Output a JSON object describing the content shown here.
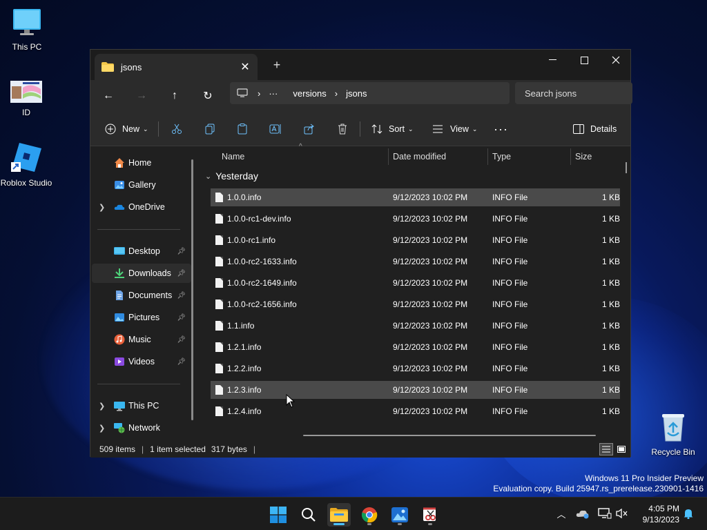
{
  "desktop": {
    "icons": [
      {
        "label": "This PC"
      },
      {
        "label": "ID"
      },
      {
        "label": "Roblox Studio"
      },
      {
        "label": "Recycle Bin"
      }
    ],
    "watermark_line1": "Windows 11 Pro Insider Preview",
    "watermark_line2": "Evaluation copy. Build 25947.rs_prerelease.230901-1416"
  },
  "window": {
    "tab_title": "jsons",
    "new_tab": "+",
    "breadcrumbs": [
      "···",
      "versions",
      "jsons"
    ],
    "search_placeholder": "Search jsons",
    "commands": {
      "new": "New",
      "sort": "Sort",
      "view": "View",
      "details": "Details"
    }
  },
  "nav_pane": {
    "items": [
      {
        "label": "Home"
      },
      {
        "label": "Gallery"
      },
      {
        "label": "OneDrive"
      },
      {
        "label": "Desktop"
      },
      {
        "label": "Downloads"
      },
      {
        "label": "Documents"
      },
      {
        "label": "Pictures"
      },
      {
        "label": "Music"
      },
      {
        "label": "Videos"
      },
      {
        "label": "This PC"
      },
      {
        "label": "Network"
      }
    ]
  },
  "file_list": {
    "columns": [
      "Name",
      "Date modified",
      "Type",
      "Size"
    ],
    "group": "Yesterday",
    "rows": [
      {
        "name": "1.0.0.info",
        "date": "9/12/2023 10:02 PM",
        "type": "INFO File",
        "size": "1 KB"
      },
      {
        "name": "1.0.0-rc1-dev.info",
        "date": "9/12/2023 10:02 PM",
        "type": "INFO File",
        "size": "1 KB"
      },
      {
        "name": "1.0.0-rc1.info",
        "date": "9/12/2023 10:02 PM",
        "type": "INFO File",
        "size": "1 KB"
      },
      {
        "name": "1.0.0-rc2-1633.info",
        "date": "9/12/2023 10:02 PM",
        "type": "INFO File",
        "size": "1 KB"
      },
      {
        "name": "1.0.0-rc2-1649.info",
        "date": "9/12/2023 10:02 PM",
        "type": "INFO File",
        "size": "1 KB"
      },
      {
        "name": "1.0.0-rc2-1656.info",
        "date": "9/12/2023 10:02 PM",
        "type": "INFO File",
        "size": "1 KB"
      },
      {
        "name": "1.1.info",
        "date": "9/12/2023 10:02 PM",
        "type": "INFO File",
        "size": "1 KB"
      },
      {
        "name": "1.2.1.info",
        "date": "9/12/2023 10:02 PM",
        "type": "INFO File",
        "size": "1 KB"
      },
      {
        "name": "1.2.2.info",
        "date": "9/12/2023 10:02 PM",
        "type": "INFO File",
        "size": "1 KB"
      },
      {
        "name": "1.2.3.info",
        "date": "9/12/2023 10:02 PM",
        "type": "INFO File",
        "size": "1 KB"
      },
      {
        "name": "1.2.4.info",
        "date": "9/12/2023 10:02 PM",
        "type": "INFO File",
        "size": "1 KB"
      }
    ]
  },
  "status_bar": {
    "item_count": "509 items",
    "selection": "1 item selected",
    "size": "317 bytes"
  },
  "taskbar": {
    "time": "4:05 PM",
    "date": "9/13/2023"
  }
}
